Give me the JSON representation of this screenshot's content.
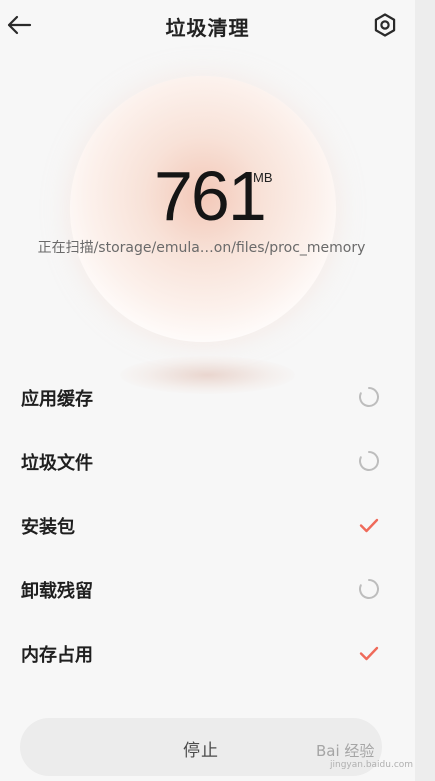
{
  "header": {
    "title": "垃圾清理",
    "back_icon": "arrow-left-icon",
    "settings_icon": "gear-icon"
  },
  "scan": {
    "size_value": "761",
    "size_unit": "MB",
    "path_text": "正在扫描/storage/emula…on/files/proc_memory"
  },
  "items": [
    {
      "label": "应用缓存",
      "status": "scanning",
      "icon": "spinner-icon"
    },
    {
      "label": "垃圾文件",
      "status": "scanning",
      "icon": "spinner-icon"
    },
    {
      "label": "安装包",
      "status": "done",
      "icon": "check-icon"
    },
    {
      "label": "卸载残留",
      "status": "scanning",
      "icon": "spinner-icon"
    },
    {
      "label": "内存占用",
      "status": "done",
      "icon": "check-icon"
    }
  ],
  "footer": {
    "stop_label": "停止"
  },
  "watermark": {
    "text": "Bai 经验",
    "sub": "jingyan.baidu.com"
  },
  "colors": {
    "accent_check": "#ef6a5a",
    "spinner": "#bdbdbd",
    "background": "#f7f7f7"
  }
}
